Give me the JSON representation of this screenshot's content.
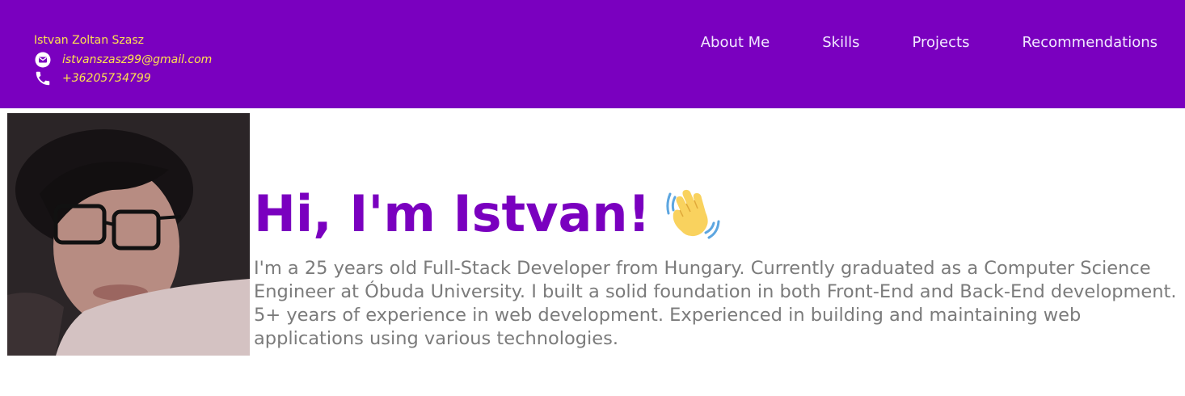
{
  "header": {
    "name": "Istvan Zoltan Szasz",
    "email": "istvanszasz99@gmail.com",
    "phone": "+36205734799",
    "icons": {
      "email": "envelope-icon",
      "phone": "phone-icon"
    },
    "colors": {
      "background": "#7a00bf",
      "contact_text": "#ffe14d",
      "nav_text": "#f1e8ff"
    }
  },
  "nav": {
    "items": [
      {
        "label": "About Me"
      },
      {
        "label": "Skills"
      },
      {
        "label": "Projects"
      },
      {
        "label": "Recommendations"
      }
    ]
  },
  "hero": {
    "title": "Hi, I'm Istvan!",
    "title_icon": "waving-hand-icon",
    "description": "I'm a 25 years old Full-Stack Developer from Hungary. Currently graduated as a Computer Science Engineer at Óbuda University. I built a solid foundation in both Front-End and Back-End development. 5+ years of experience in web development. Experienced in building and maintaining web applications using various technologies.",
    "colors": {
      "title": "#7a00bf",
      "text": "#7b7b7b"
    }
  }
}
